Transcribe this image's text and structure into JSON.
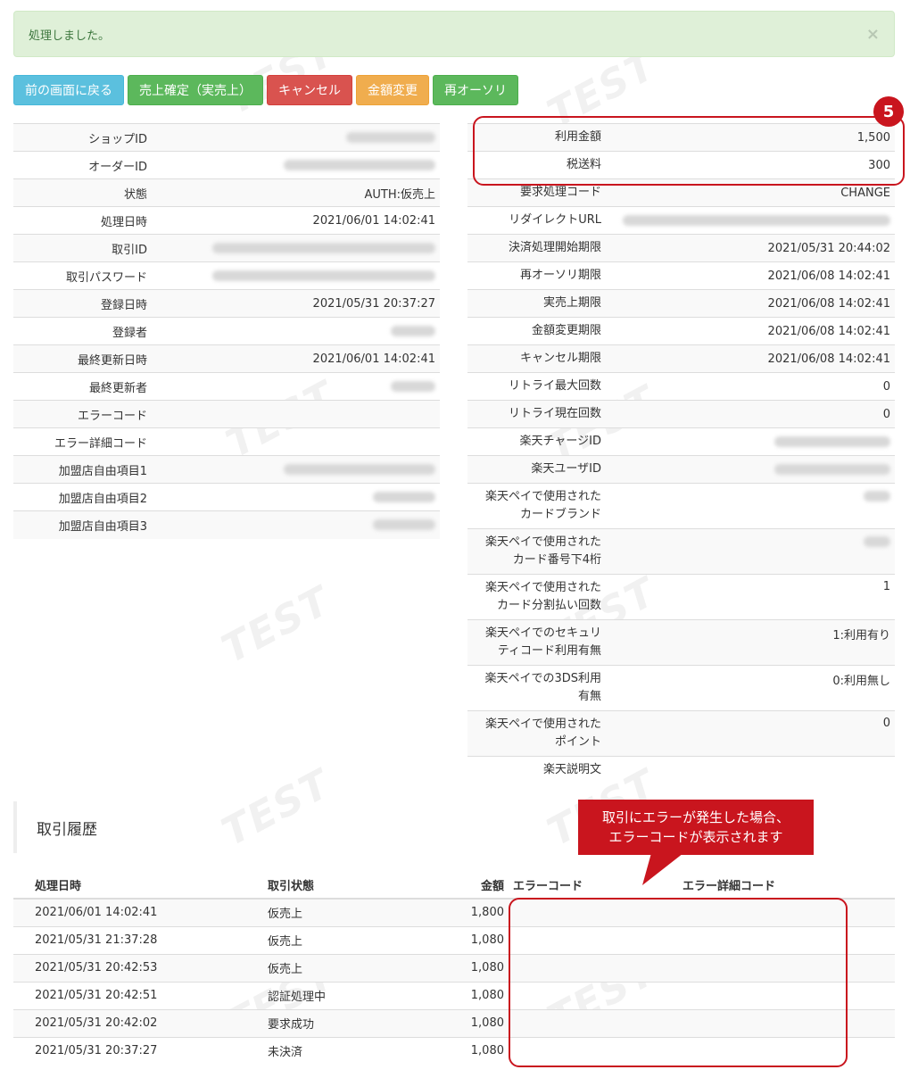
{
  "alert": {
    "message": "処理しました。",
    "close": "×"
  },
  "buttons": {
    "back": "前の画面に戻る",
    "confirm_sale": "売上確定（実売上）",
    "cancel": "キャンセル",
    "change_amount": "金額変更",
    "reauth": "再オーソリ"
  },
  "left_table": [
    {
      "label": "ショップID",
      "value": ""
    },
    {
      "label": "オーダーID",
      "value": ""
    },
    {
      "label": "状態",
      "value": "AUTH:仮売上"
    },
    {
      "label": "処理日時",
      "value": "2021/06/01 14:02:41"
    },
    {
      "label": "取引ID",
      "value": ""
    },
    {
      "label": "取引パスワード",
      "value": ""
    },
    {
      "label": "登録日時",
      "value": "2021/05/31 20:37:27"
    },
    {
      "label": "登録者",
      "value": ""
    },
    {
      "label": "最終更新日時",
      "value": "2021/06/01 14:02:41"
    },
    {
      "label": "最終更新者",
      "value": ""
    },
    {
      "label": "エラーコード",
      "value": ""
    },
    {
      "label": "エラー詳細コード",
      "value": ""
    },
    {
      "label": "加盟店自由項目1",
      "value": ""
    },
    {
      "label": "加盟店自由項目2",
      "value": ""
    },
    {
      "label": "加盟店自由項目3",
      "value": ""
    }
  ],
  "right_table": [
    {
      "label": "利用金額",
      "value": "1,500"
    },
    {
      "label": "税送料",
      "value": "300"
    },
    {
      "label": "要求処理コード",
      "value": "CHANGE"
    },
    {
      "label": "リダイレクトURL",
      "value": ""
    },
    {
      "label": "決済処理開始期限",
      "value": "2021/05/31 20:44:02"
    },
    {
      "label": "再オーソリ期限",
      "value": "2021/06/08 14:02:41"
    },
    {
      "label": "実売上期限",
      "value": "2021/06/08 14:02:41"
    },
    {
      "label": "金額変更期限",
      "value": "2021/06/08 14:02:41"
    },
    {
      "label": "キャンセル期限",
      "value": "2021/06/08 14:02:41"
    },
    {
      "label": "リトライ最大回数",
      "value": "0"
    },
    {
      "label": "リトライ現在回数",
      "value": "0"
    },
    {
      "label": "楽天チャージID",
      "value": ""
    },
    {
      "label": "楽天ユーザID",
      "value": ""
    },
    {
      "label": "楽天ペイで使用されたカードブランド",
      "value": "",
      "line1": "楽天ペイで使用された",
      "line2": "カードブランド"
    },
    {
      "label": "楽天ペイで使用されたカード番号下4桁",
      "value": "",
      "line1": "楽天ペイで使用された",
      "line2": "カード番号下4桁"
    },
    {
      "label": "楽天ペイで使用されたカード分割払い回数",
      "value": "1",
      "line1": "楽天ペイで使用された",
      "line2": "カード分割払い回数"
    },
    {
      "label": "楽天ペイでのセキュリティコード利用有無",
      "value": "1:利用有り",
      "line1": "楽天ペイでのセキュリ",
      "line2": "ティコード利用有無"
    },
    {
      "label": "楽天ペイでの3DS利用有無",
      "value": "0:利用無し",
      "line1": "楽天ペイでの3DS利用",
      "line2": "有無"
    },
    {
      "label": "楽天ペイで使用されたポイント",
      "value": "0",
      "line1": "楽天ペイで使用された",
      "line2": "ポイント"
    },
    {
      "label": "楽天説明文",
      "value": ""
    }
  ],
  "history": {
    "title": "取引履歴",
    "headers": [
      "処理日時",
      "取引状態",
      "金額",
      "エラーコード",
      "エラー詳細コード"
    ],
    "rows": [
      [
        "2021/06/01 14:02:41",
        "仮売上",
        "1,800",
        "",
        ""
      ],
      [
        "2021/05/31 21:37:28",
        "仮売上",
        "1,080",
        "",
        ""
      ],
      [
        "2021/05/31 20:42:53",
        "仮売上",
        "1,080",
        "",
        ""
      ],
      [
        "2021/05/31 20:42:51",
        "認証処理中",
        "1,080",
        "",
        ""
      ],
      [
        "2021/05/31 20:42:02",
        "要求成功",
        "1,080",
        "",
        ""
      ],
      [
        "2021/05/31 20:37:27",
        "未決済",
        "1,080",
        "",
        ""
      ]
    ]
  },
  "annotations": {
    "badge": "5",
    "callout_line1": "取引にエラーが発生した場合、",
    "callout_line2": "エラーコードが表示されます"
  },
  "watermark": "TEST",
  "colors": {
    "annotation_red": "#c9151e",
    "alert_bg": "#dff0d8"
  }
}
